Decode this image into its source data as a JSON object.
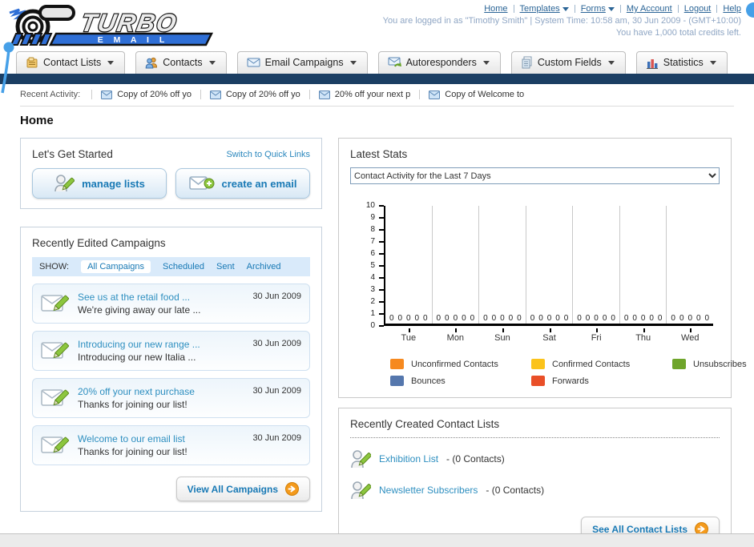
{
  "header": {
    "logo": {
      "line1": "TURBO",
      "line2": "E M A I L"
    },
    "nav_links": [
      "Home",
      "Templates",
      "Forms",
      "My Account",
      "Logout",
      "Help"
    ],
    "login_text": "You are logged in as \"Timothy Smith\" | System Time: 10:58 am, 30 Jun 2009 - (GMT+10:00)",
    "credits_text": "You have 1,000 total credits left."
  },
  "nav_tabs": [
    {
      "label": "Contact Lists",
      "icon": "contact-lists-icon"
    },
    {
      "label": "Contacts",
      "icon": "contacts-icon"
    },
    {
      "label": "Email Campaigns",
      "icon": "email-campaigns-icon"
    },
    {
      "label": "Autoresponders",
      "icon": "autoresponders-icon"
    },
    {
      "label": "Custom Fields",
      "icon": "custom-fields-icon"
    },
    {
      "label": "Statistics",
      "icon": "statistics-icon"
    }
  ],
  "recent_activity": {
    "label": "Recent Activity:",
    "items": [
      "Copy of 20% off yo",
      "Copy of 20% off yo",
      "20% off your next p",
      "Copy of Welcome to"
    ]
  },
  "page_title": "Home",
  "get_started": {
    "title": "Let's Get Started",
    "switch_link": "Switch to Quick Links",
    "manage_lists_label": "manage lists",
    "create_email_label": "create an email"
  },
  "campaigns": {
    "title": "Recently Edited Campaigns",
    "show_label": "SHOW:",
    "filters": [
      "All Campaigns",
      "Scheduled",
      "Sent",
      "Archived"
    ],
    "active_filter": "All Campaigns",
    "items": [
      {
        "title": "See us at the retail food ...",
        "subtitle": "We're giving away our late ...",
        "date": "30 Jun 2009"
      },
      {
        "title": "Introducing our new range ...",
        "subtitle": "Introducing our new Italia ...",
        "date": "30 Jun 2009"
      },
      {
        "title": "20% off your next purchase",
        "subtitle": "Thanks for joining our list!",
        "date": "30 Jun 2009"
      },
      {
        "title": "Welcome to our email list",
        "subtitle": "Thanks for joining our list!",
        "date": "30 Jun 2009"
      }
    ],
    "view_all_label": "View All Campaigns"
  },
  "stats": {
    "title": "Latest Stats",
    "dropdown_value": "Contact Activity for the Last 7 Days",
    "chart_data": {
      "type": "bar",
      "categories": [
        "Tue",
        "Mon",
        "Sun",
        "Sat",
        "Fri",
        "Thu",
        "Wed"
      ],
      "series": [
        {
          "name": "Unconfirmed Contacts",
          "color": "#F6891F",
          "values": [
            0,
            0,
            0,
            0,
            0,
            0,
            0
          ]
        },
        {
          "name": "Confirmed Contacts",
          "color": "#FBC31B",
          "values": [
            0,
            0,
            0,
            0,
            0,
            0,
            0
          ]
        },
        {
          "name": "Unsubscribes",
          "color": "#6FA52B",
          "values": [
            0,
            0,
            0,
            0,
            0,
            0,
            0
          ]
        },
        {
          "name": "Bounces",
          "color": "#5577AD",
          "values": [
            0,
            0,
            0,
            0,
            0,
            0,
            0
          ]
        },
        {
          "name": "Forwards",
          "color": "#E94F28",
          "values": [
            0,
            0,
            0,
            0,
            0,
            0,
            0
          ]
        }
      ],
      "ylim": [
        0,
        10
      ],
      "yticks": [
        0,
        1,
        2,
        3,
        4,
        5,
        6,
        7,
        8,
        9,
        10
      ],
      "grid": "vertical-between-groups",
      "legend_position": "bottom"
    }
  },
  "contact_lists": {
    "title": "Recently Created Contact Lists",
    "items": [
      {
        "name": "Exhibition List",
        "count": "- (0 Contacts)"
      },
      {
        "name": "Newsletter Subscribers",
        "count": "- (0 Contacts)"
      }
    ],
    "see_all_label": "See All Contact Lists"
  },
  "colors": {
    "navy_bar": "#1B3E63",
    "accent_blue": "#1879B5",
    "link_blue": "#2A6496",
    "logo_blue": "#2F6FD6",
    "bubble_blue": "#46A0E8",
    "button_orange": "#F49A1C"
  }
}
